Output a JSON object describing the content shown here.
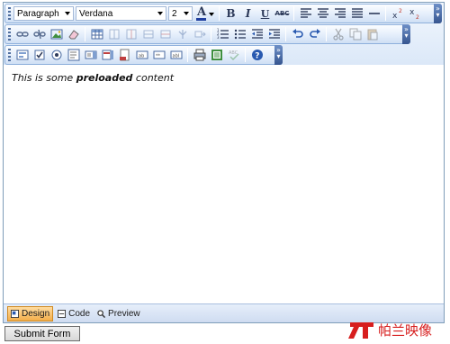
{
  "toolbar": {
    "format_select": "Paragraph",
    "font_select": "Verdana",
    "size_select": "2",
    "bold": "B",
    "italic": "I",
    "underline": "U",
    "strikethrough": "ABC",
    "font_color_letter": "A"
  },
  "content": {
    "text_before": "This is some ",
    "text_bold": "preloaded",
    "text_after": " content"
  },
  "modes": {
    "design": "Design",
    "code": "Code",
    "preview": "Preview"
  },
  "submit_label": "Submit Form",
  "watermark_text": "帕兰映像",
  "colors": {
    "toolbar_border": "#8eb0dc",
    "active_mode": "#f4ae4a",
    "font_color_bar": "#1f3fa0",
    "watermark_red": "#d71e1e"
  }
}
